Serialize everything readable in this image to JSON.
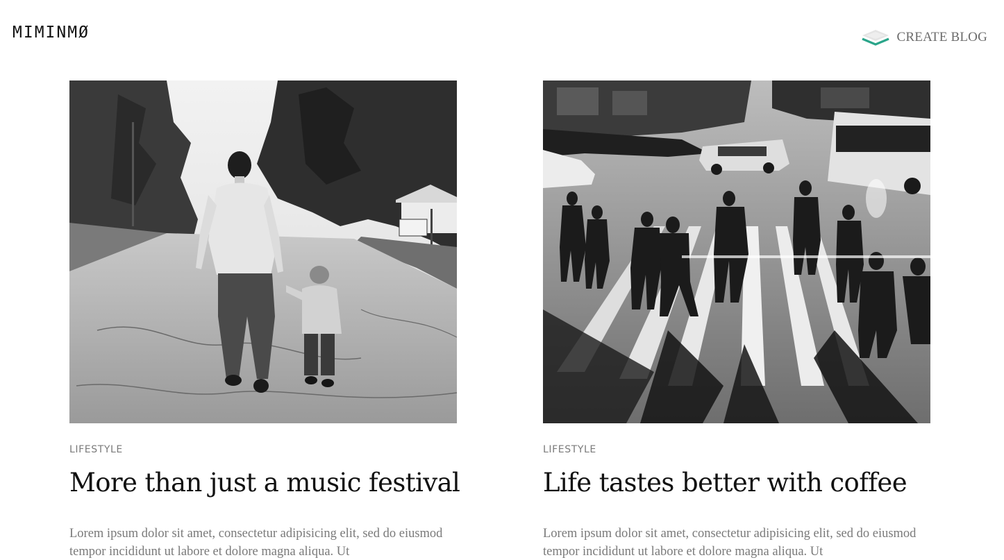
{
  "header": {
    "logo": "MIMINMØ",
    "create_blog_label": "CREATE BLOG",
    "create_blog_icon": "layers-icon",
    "accent_color": "#2aa58a"
  },
  "posts": [
    {
      "image_alt": "Father and son walking hand in hand on a road",
      "category": "LIFESTYLE",
      "title": "More than just a music festival",
      "excerpt": "Lorem ipsum dolor sit amet, consectetur adipisicing elit, sed do eiusmod tempor incididunt ut labore et dolore magna aliqua. Ut"
    },
    {
      "image_alt": "Crowd of pedestrians crossing a busy city street",
      "category": "LIFESTYLE",
      "title": "Life tastes better with coffee",
      "excerpt": "Lorem ipsum dolor sit amet, consectetur adipisicing elit, sed do eiusmod tempor incididunt ut labore et dolore magna aliqua. Ut"
    }
  ]
}
